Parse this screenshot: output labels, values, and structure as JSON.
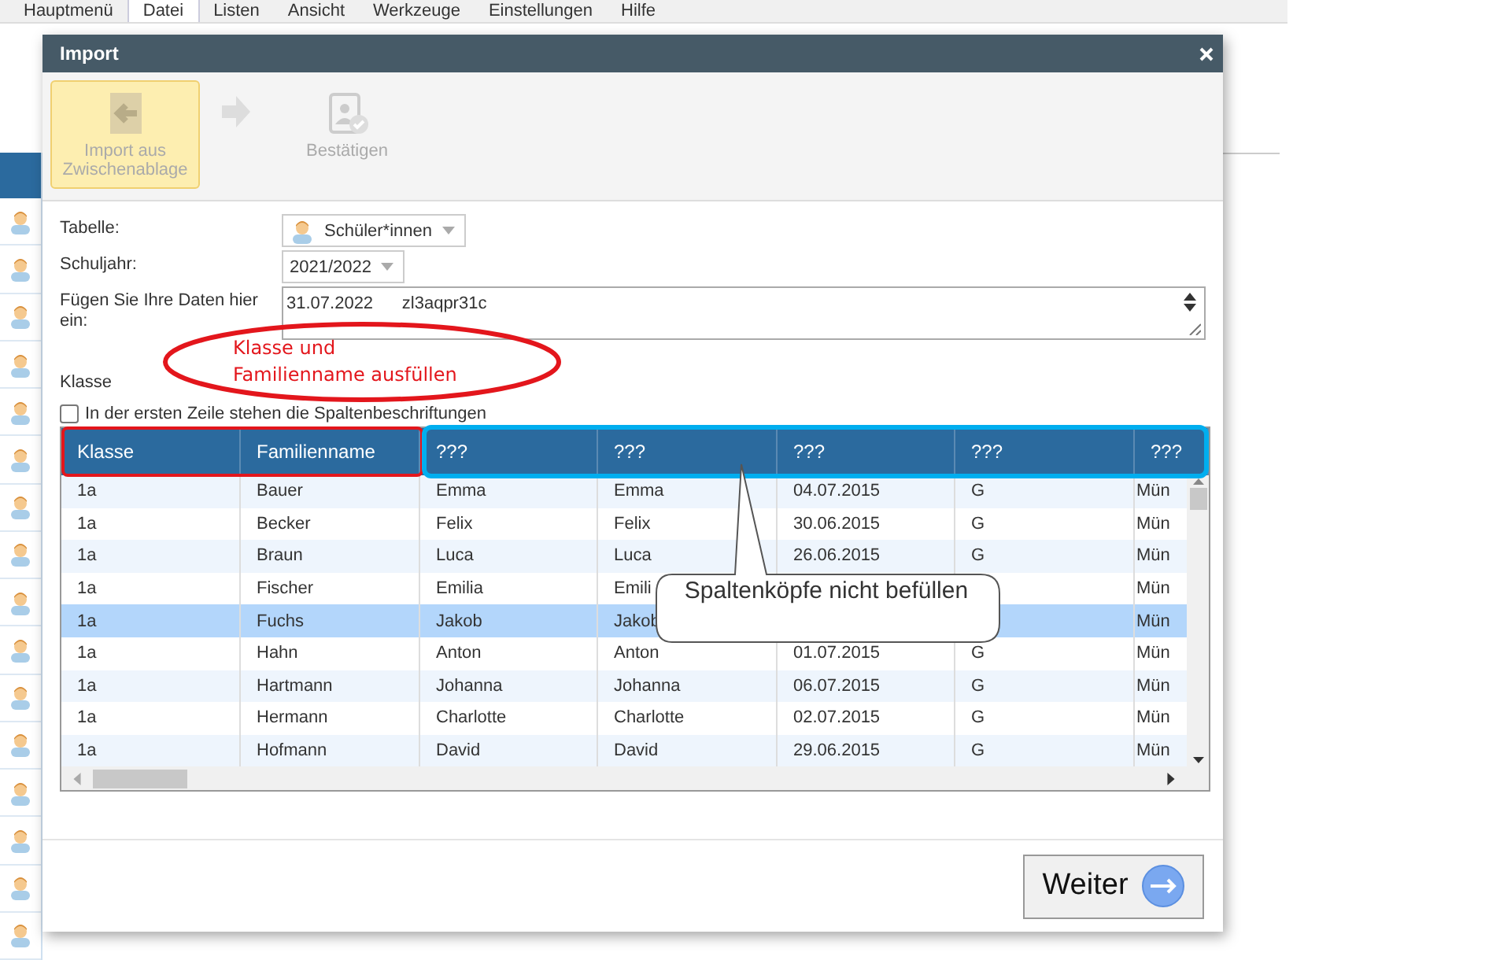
{
  "menu": [
    {
      "label": "Hauptmenü",
      "selected": false
    },
    {
      "label": "Datei",
      "selected": true
    },
    {
      "label": "Listen",
      "selected": false
    },
    {
      "label": "Ansicht",
      "selected": false
    },
    {
      "label": "Werkzeuge",
      "selected": false
    },
    {
      "label": "Einstellungen",
      "selected": false
    },
    {
      "label": "Hilfe",
      "selected": false
    }
  ],
  "dialog": {
    "title": "Import",
    "steps": [
      {
        "label": "Import aus Zwischenablage",
        "selected": true
      },
      {
        "label": "Bestätigen",
        "selected": false
      }
    ],
    "form": {
      "table": {
        "label": "Tabelle:",
        "value": "Schüler*innen"
      },
      "school_year": {
        "label": "Schuljahr:",
        "value": "2021/2022"
      },
      "data": {
        "label": "Fügen Sie Ihre Daten hier ein:",
        "value": "31.07.2022      zl3aqpr31c"
      },
      "klasse_label": "Klasse",
      "header_checkbox": {
        "label": "In der ersten Zeile stehen die Spaltenbeschriftungen",
        "checked": false
      }
    },
    "table": {
      "columns": [
        "Klasse",
        "Familienname",
        "???",
        "???",
        "???",
        "???",
        "???"
      ],
      "rows": [
        {
          "cells": [
            "1a",
            "Bauer",
            "Emma",
            "Emma",
            "04.07.2015",
            "G",
            "Mün"
          ],
          "selected": false
        },
        {
          "cells": [
            "1a",
            "Becker",
            "Felix",
            "Felix",
            "30.06.2015",
            "G",
            "Mün"
          ],
          "selected": false
        },
        {
          "cells": [
            "1a",
            "Braun",
            "Luca",
            "Luca",
            "26.06.2015",
            "G",
            "Mün"
          ],
          "selected": false
        },
        {
          "cells": [
            "1a",
            "Fischer",
            "Emilia",
            "Emili",
            "",
            "",
            "Mün"
          ],
          "selected": false
        },
        {
          "cells": [
            "1a",
            "Fuchs",
            "Jakob",
            "Jakob",
            "",
            "",
            "Mün"
          ],
          "selected": true
        },
        {
          "cells": [
            "1a",
            "Hahn",
            "Anton",
            "Anton",
            "01.07.2015",
            "G",
            "Mün"
          ],
          "selected": false
        },
        {
          "cells": [
            "1a",
            "Hartmann",
            "Johanna",
            "Johanna",
            "06.07.2015",
            "G",
            "Mün"
          ],
          "selected": false
        },
        {
          "cells": [
            "1a",
            "Hermann",
            "Charlotte",
            "Charlotte",
            "02.07.2015",
            "G",
            "Mün"
          ],
          "selected": false
        },
        {
          "cells": [
            "1a",
            "Hofmann",
            "David",
            "David",
            "29.06.2015",
            "G",
            "Mün"
          ],
          "selected": false
        }
      ]
    },
    "next_button": "Weiter"
  },
  "annotations": {
    "fill_note_lines": [
      "Klasse und",
      "Familienname ausfüllen"
    ],
    "bubble_note": "Spaltenköpfe nicht befüllen"
  }
}
